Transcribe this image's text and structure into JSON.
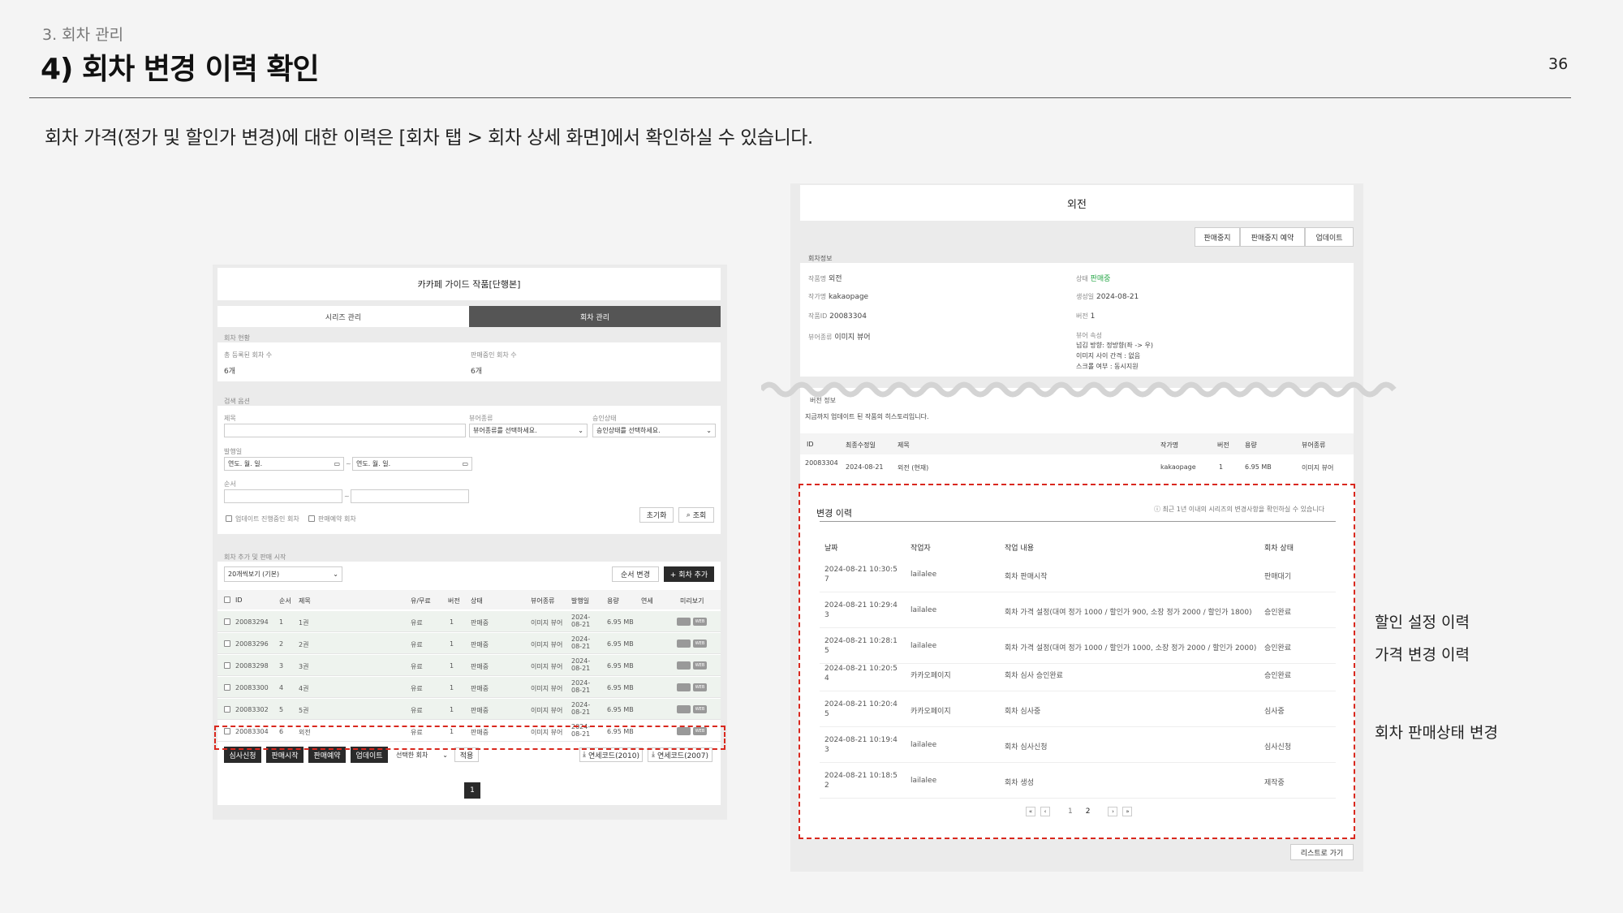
{
  "header": {
    "section": "3. 회차 관리",
    "title": "4) 회차 변경 이력 확인",
    "page_number": "36",
    "intro": "회차 가격(정가 및 할인가 변경)에 대한 이력은 [회차 탭 > 회차 상세 화면]에서 확인하실 수 있습니다."
  },
  "left_panel": {
    "title": "카카페 가이드 작품[단행본]",
    "tabs": [
      "시리즈 관리",
      "회차 관리"
    ],
    "status_section": "회차 현황",
    "total_label": "총 등록된 회차 수",
    "total_value": "6개",
    "selling_label": "판매중인 회차 수",
    "selling_value": "6개",
    "search_section": "검색 옵션",
    "title_label": "제목",
    "viewer_label": "뷰어종류",
    "viewer_placeholder": "뷰어종류를 선택하세요.",
    "approval_label": "승인상태",
    "approval_placeholder": "승인상태를 선택하세요.",
    "date_label": "발행일",
    "date_placeholder": "연도. 월. 일.",
    "order_label": "순서",
    "range_sep": "~",
    "check_update": "업데이트 진행중인 회차",
    "check_reserve": "판매예약 회차",
    "reset_btn": "초기화",
    "search_btn": "조회",
    "add_section": "회차 추가 및 판매 시작",
    "page_size": "20개씩보기 (기본)",
    "reorder_btn": "순서 변경",
    "add_btn": "+ 회차 추가",
    "columns": [
      "ID",
      "순서",
      "제목",
      "유/무료",
      "버전",
      "상태",
      "뷰어종류",
      "발행일",
      "용량",
      "연세",
      "미리보기"
    ],
    "rows": [
      {
        "id": "20083294",
        "order": "1",
        "title": "1권",
        "paid": "유료",
        "ver": "1",
        "status": "판매중",
        "viewer": "이미지 뷰어",
        "date": "2024-08-21",
        "size": "6.95 MB",
        "web": "WEB"
      },
      {
        "id": "20083296",
        "order": "2",
        "title": "2권",
        "paid": "유료",
        "ver": "1",
        "status": "판매중",
        "viewer": "이미지 뷰어",
        "date": "2024-08-21",
        "size": "6.95 MB",
        "web": "WEB"
      },
      {
        "id": "20083298",
        "order": "3",
        "title": "3권",
        "paid": "유료",
        "ver": "1",
        "status": "판매중",
        "viewer": "이미지 뷰어",
        "date": "2024-08-21",
        "size": "6.95 MB",
        "web": "WEB"
      },
      {
        "id": "20083300",
        "order": "4",
        "title": "4권",
        "paid": "유료",
        "ver": "1",
        "status": "판매중",
        "viewer": "이미지 뷰어",
        "date": "2024-08-21",
        "size": "6.95 MB",
        "web": "WEB"
      },
      {
        "id": "20083302",
        "order": "5",
        "title": "5권",
        "paid": "유료",
        "ver": "1",
        "status": "판매중",
        "viewer": "이미지 뷰어",
        "date": "2024-08-21",
        "size": "6.95 MB",
        "web": "WEB"
      },
      {
        "id": "20083304",
        "order": "6",
        "title": "외전",
        "paid": "유료",
        "ver": "1",
        "status": "판매중",
        "viewer": "이미지 뷰어",
        "date": "2024-08-21",
        "size": "6.95 MB",
        "web": "WEB"
      }
    ],
    "actions": [
      "심사신청",
      "판매시작",
      "판매예약",
      "업데이트"
    ],
    "selected": "선택한 회차",
    "apply_btn": "적용",
    "download1": "연세코드(2010)",
    "download2": "연세코드(2007)",
    "page": "1"
  },
  "right_panel": {
    "title": "외전",
    "buttons": [
      "판매중지",
      "판매중지 예약",
      "업데이트"
    ],
    "info_section": "회차정보",
    "work_label": "작품명",
    "work_value": "외전",
    "status_label": "상태",
    "status_value": "판매중",
    "author_label": "작가명",
    "author_value": "kakaopage",
    "created_label": "생성일",
    "created_value": "2024-08-21",
    "id_label": "작품ID",
    "id_value": "20083304",
    "version_label": "버전",
    "version_value": "1",
    "viewer_label": "뷰어종류",
    "viewer_value": "이미지 뷰어",
    "attr_label": "뷰어 속성",
    "attr_lines": [
      "넘김 방향: 정방향(좌 -> 우)",
      "이미지 사이 간격 : 없음",
      "스크롤 여부 : 동시지원"
    ],
    "version_section": "버전 정보",
    "version_desc": "지금까지 업데이트 된 작품의 히스토리입니다.",
    "version_columns": [
      "ID",
      "최종수정일",
      "제목",
      "작가명",
      "버전",
      "용량",
      "뷰어종류"
    ],
    "version_row": {
      "id": "20083304",
      "date": "2024-08-21",
      "title": "외전 (현재)",
      "author": "kakaopage",
      "ver": "1",
      "size": "6.95 MB",
      "viewer": "이미지 뷰어"
    },
    "history_title": "변경 이력",
    "history_note": "최근 1년 이내의 시리즈의 변경사항을 확인하실 수 있습니다",
    "history_columns": [
      "날짜",
      "작업자",
      "작업 내용",
      "회차 상태"
    ],
    "history_rows": [
      {
        "date": "2024-08-21 10:30:57",
        "user": "lailalee",
        "content": "회차 판매시작",
        "state": "판매대기"
      },
      {
        "date": "2024-08-21 10:29:43",
        "user": "lailalee",
        "content": "회차 가격 설정(대여 정가 1000 / 할인가 900, 소장 정가 2000 / 할인가 1800)",
        "state": "승인완료"
      },
      {
        "date": "2024-08-21 10:28:15",
        "user": "lailalee",
        "content": "회차 가격 설정(대여 정가 1000 / 할인가 1000, 소장 정가 2000 / 할인가 2000)",
        "state": "승인완료"
      },
      {
        "date": "2024-08-21 10:20:54",
        "user": "카카오페이지",
        "content": "회차 심사 승인완료",
        "state": "승인완료"
      },
      {
        "date": "2024-08-21 10:20:45",
        "user": "카카오페이지",
        "content": "회차 심사중",
        "state": "심사중"
      },
      {
        "date": "2024-08-21 10:19:43",
        "user": "lailalee",
        "content": "회차 심사신청",
        "state": "심사신청"
      },
      {
        "date": "2024-08-21 10:18:52",
        "user": "lailalee",
        "content": "회차 생성",
        "state": "제작중"
      }
    ],
    "pages": [
      "1",
      "2"
    ],
    "list_btn": "리스트로 가기"
  },
  "annotations": {
    "discount": "할인 설정 이력",
    "price": "가격 변경 이력",
    "sale_state": "회차 판매상태 변경"
  },
  "colors": {
    "accent_red": "#d9281e",
    "status_green": "#2aa84a",
    "dark": "#2a2a2a"
  }
}
